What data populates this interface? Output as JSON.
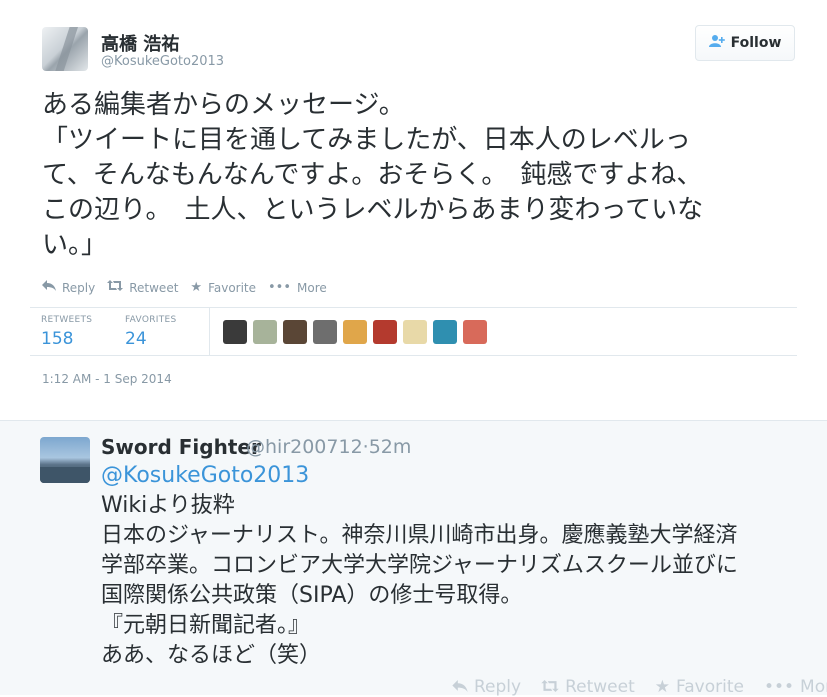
{
  "tweet": {
    "author_name": "高橋 浩祐",
    "author_handle": "@KosukeGoto2013",
    "follow_label": "Follow",
    "text_lines": [
      "ある編集者からのメッセージ。",
      "「ツイートに目を通してみましたが、日本人のレベルっ",
      "て、そんなもんなんですよ。おそらく。　鈍感ですよね、",
      "この辺り。　土人、というレベルからあまり変わっていな",
      "い。」"
    ],
    "actions": {
      "reply": "Reply",
      "retweet": "Retweet",
      "favorite": "Favorite",
      "more": "More"
    },
    "stats": {
      "retweets_label": "RETWEETS",
      "retweets_value": "158",
      "favorites_label": "FAVORITES",
      "favorites_value": "24"
    },
    "favoriter_avatar_colors": [
      "#3a3a3a",
      "#a7b39a",
      "#5a4636",
      "#6e6e6e",
      "#e0a64a",
      "#b43a2e",
      "#e8d9a8",
      "#2f8fb0",
      "#d86a5a"
    ],
    "timestamp": "1:12 AM - 1 Sep 2014"
  },
  "reply": {
    "author_name": "Sword Fighter",
    "author_handle": "@hir200712",
    "separator": "·",
    "age": "52m",
    "mention": "@KosukeGoto2013",
    "text_lines": [
      "Wikiより抜粋",
      "日本のジャーナリスト。神奈川県川崎市出身。慶應義塾大学経済",
      "学部卒業。コロンビア大学大学院ジャーナリズムスクール並びに",
      "国際関係公共政策（SIPA）の修士号取得。",
      "『元朝日新聞記者。』",
      "ああ、なるほど（笑）"
    ],
    "actions": {
      "reply": "Reply",
      "retweet": "Retweet",
      "favorite": "Favorite",
      "more": "More"
    }
  },
  "icons": {
    "follow": "add-user-icon",
    "reply": "reply-arrow-icon",
    "retweet": "retweet-icon",
    "favorite": "star-icon",
    "more": "ellipsis-icon"
  },
  "colors": {
    "link": "#3b94d9",
    "muted": "#8899a6",
    "text": "#292f33",
    "reply_background": "#f5f8fa"
  }
}
